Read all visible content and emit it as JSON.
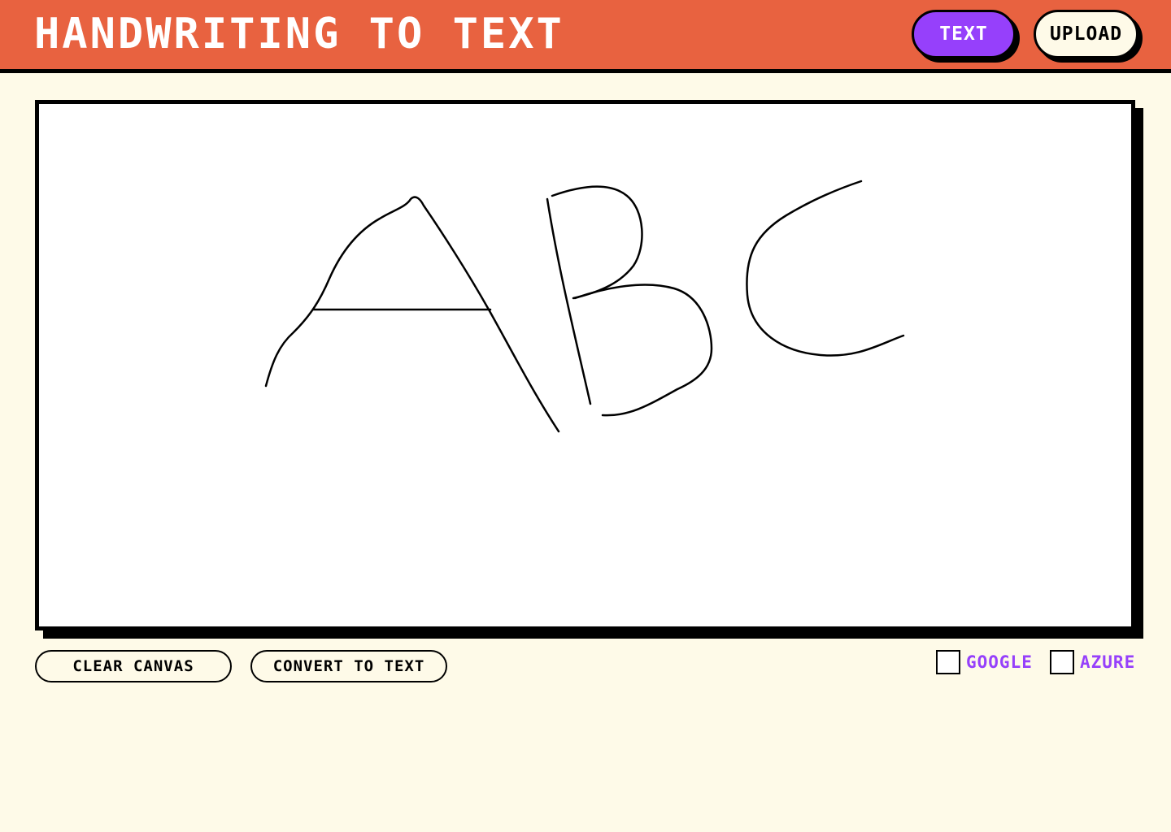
{
  "header": {
    "title": "HANDWRITING TO TEXT",
    "mode_buttons": {
      "text_label": "TEXT",
      "upload_label": "UPLOAD"
    }
  },
  "canvas": {
    "handwritten_content": "ABC",
    "stroke_color": "#000000",
    "background_color": "#ffffff"
  },
  "actions": {
    "clear_label": "CLEAR CANVAS",
    "convert_label": "CONVERT TO TEXT"
  },
  "engines": [
    {
      "label": "GOOGLE",
      "checked": false
    },
    {
      "label": "AZURE",
      "checked": false
    }
  ],
  "colors": {
    "header_background": "#e86240",
    "page_background": "#fefae8",
    "accent_purple": "#9640fb",
    "outline": "#000000"
  }
}
